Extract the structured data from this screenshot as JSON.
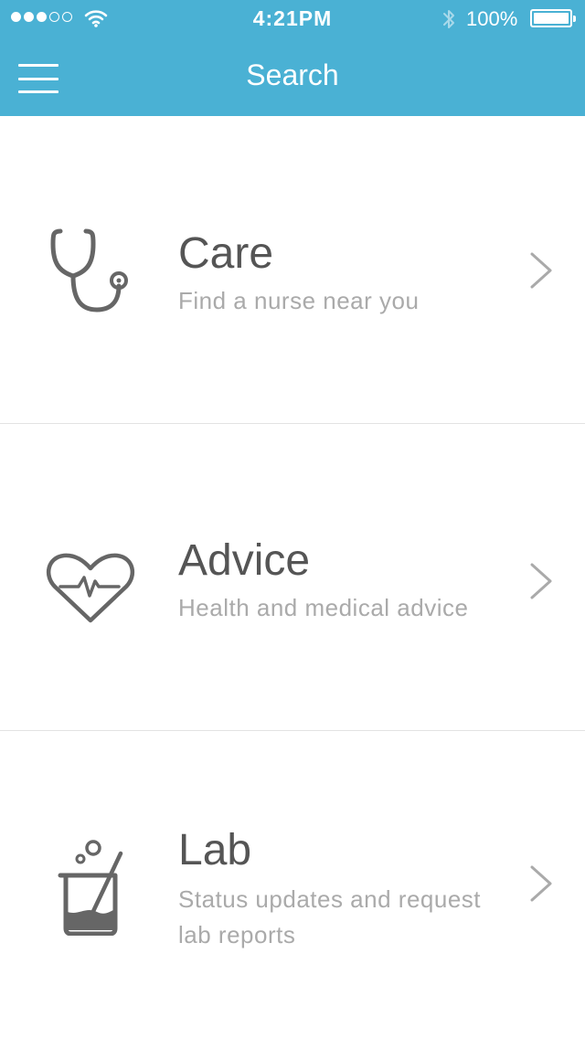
{
  "status_bar": {
    "time": "4:21PM",
    "battery": "100%"
  },
  "header": {
    "title": "Search",
    "background_color": "#4ab1d4"
  },
  "rows": [
    {
      "icon": "stethoscope-icon",
      "title": "Care",
      "subtitle": "Find a nurse near you"
    },
    {
      "icon": "heart-pulse-icon",
      "title": "Advice",
      "subtitle": "Health and medical advice"
    },
    {
      "icon": "lab-beaker-icon",
      "title": "Lab",
      "subtitle": "Status updates and request lab reports"
    }
  ]
}
